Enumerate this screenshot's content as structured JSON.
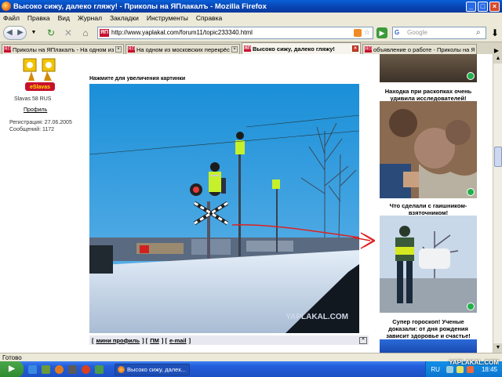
{
  "window": {
    "title": "Высоко сижу, далеко гляжу! - Приколы на ЯПлакалъ - Mozilla Firefox"
  },
  "menu": [
    "Файл",
    "Правка",
    "Вид",
    "Журнал",
    "Закладки",
    "Инструменты",
    "Справка"
  ],
  "navigation": {
    "url": "http://www.yaplakal.com/forum11/topic233340.html",
    "site_favicon": "ЯП",
    "search_engine": "G",
    "search_placeholder": "Google"
  },
  "tabs": [
    {
      "label": "Приколы на ЯПлакалъ - На одном из ...",
      "active": false
    },
    {
      "label": "На одном из московских перекрёстк...",
      "active": false
    },
    {
      "label": "Высоко сижу, далеко гляжу!",
      "active": true
    },
    {
      "label": "объявление о работе - Приколы на Я...",
      "active": false
    }
  ],
  "user": {
    "logo_text": "eSlavas",
    "name": "Slavas 58 RUS",
    "profile_link": "Профиль",
    "registered": "Регистрация: 27.06.2005",
    "posts": "Сообщений: 1172"
  },
  "post": {
    "click_hint": "Нажмите для увеличения картинки",
    "watermark": "YAPLAKAL.COM",
    "actions": {
      "mini_profile": "мини профиль",
      "pm": "ПМ",
      "email": "e-mail"
    }
  },
  "sidebar_ads": [
    {
      "caption": ""
    },
    {
      "caption": "Находка при раскопках очень удивила исследователей!"
    },
    {
      "caption": "Что сделали с гаишником-взяточником!"
    },
    {
      "caption": "Супер гороскоп! Ученые доказали: от дня рождения зависит здоровье и счастье!"
    }
  ],
  "status": {
    "text": "Готово"
  },
  "taskbar": {
    "start": "▶",
    "window_item": "Высоко сижу, далек...",
    "language": "RU",
    "brand": "YAPLAKAL.COM",
    "clock": "18:45"
  },
  "colors": {
    "title_bar": "#0a5fd8",
    "taskbar": "#245edb",
    "annotation_red": "#e02020",
    "ad_indicator_green": "#22b04a"
  }
}
